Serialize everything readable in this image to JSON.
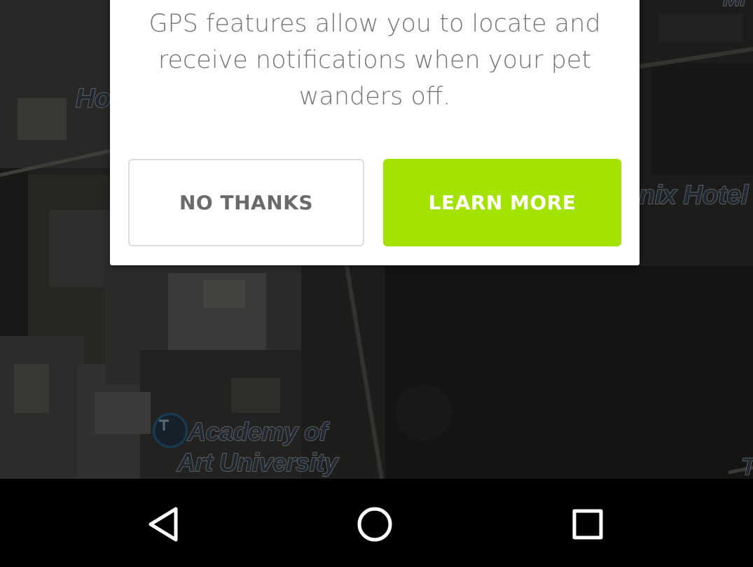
{
  "dialog": {
    "message": "GPS features allow you to locate and receive notifications when your pet wanders off.",
    "no_thanks_label": "NO THANKS",
    "learn_more_label": "LEARN MORE",
    "accent_color": "#a4e300"
  },
  "map": {
    "labels": {
      "hotel_left": "Ho",
      "hotel_right": "nix Hotel",
      "academy_line1": "Academy of",
      "academy_line2": "Art University",
      "edge_top_right": "Mi",
      "edge_bottom_right": "T"
    },
    "poi_icon": "university-poi-icon"
  },
  "navbar": {
    "back_icon": "back-triangle-icon",
    "home_icon": "home-circle-icon",
    "recents_icon": "recents-square-icon"
  }
}
